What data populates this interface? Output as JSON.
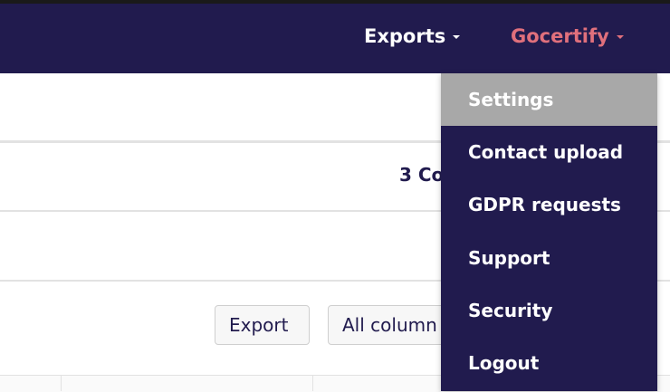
{
  "navbar": {
    "exports_label": "Exports",
    "account_label": "Gocertify",
    "exports_color": "#ffffff",
    "account_color": "#e0707c",
    "background": "#211b4e"
  },
  "summary": {
    "text": "3 Co"
  },
  "toolbar": {
    "export_label": "Export",
    "columns_label": "All column"
  },
  "dropdown": {
    "items": [
      {
        "label": "Settings",
        "active": true
      },
      {
        "label": "Contact upload"
      },
      {
        "label": "GDPR requests"
      },
      {
        "label": "Support"
      },
      {
        "label": "Security"
      },
      {
        "label": "Logout"
      }
    ]
  }
}
